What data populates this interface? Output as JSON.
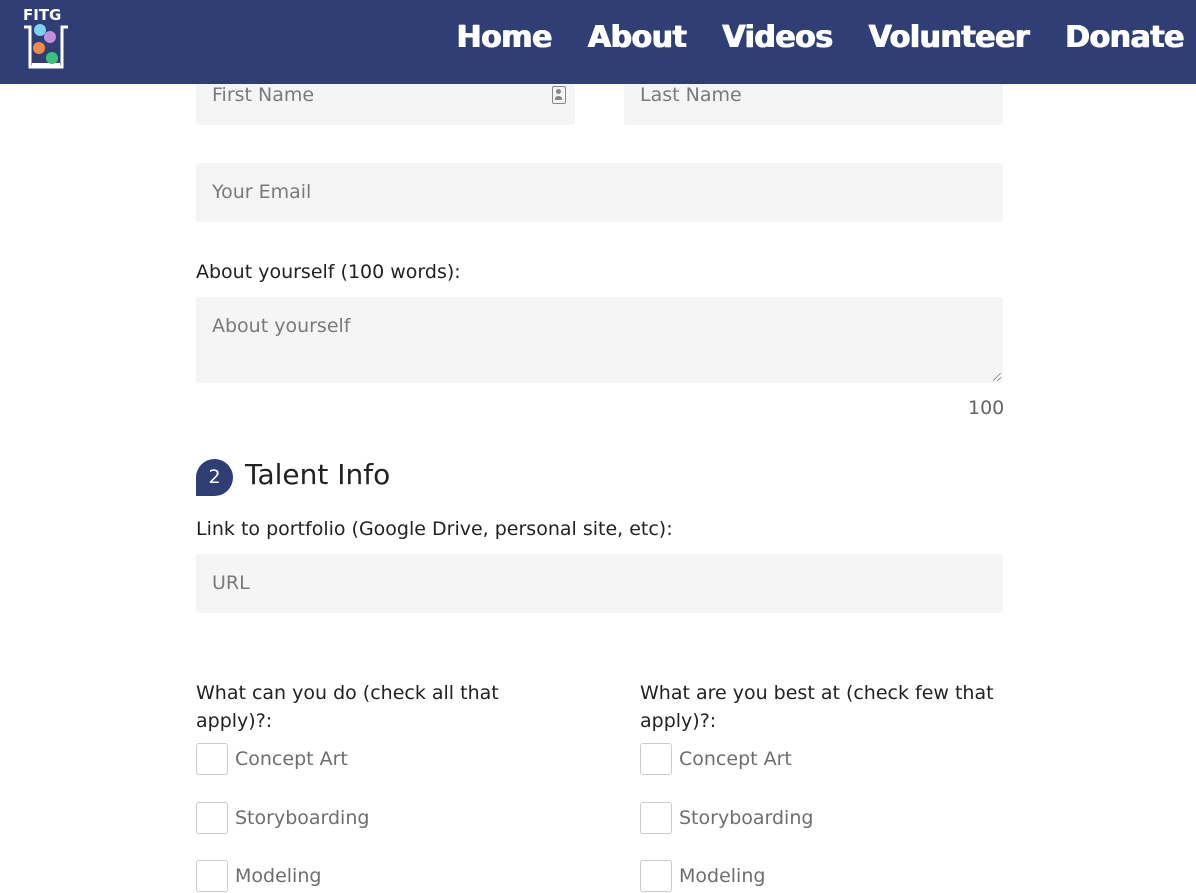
{
  "header": {
    "logo_text": "FITG",
    "nav": [
      "Home",
      "About",
      "Videos",
      "Volunteer",
      "Donate"
    ]
  },
  "form": {
    "first_name_placeholder": "First Name",
    "last_name_placeholder": "Last Name",
    "email_placeholder": "Your Email",
    "about_label": "About yourself (100 words):",
    "about_placeholder": "About yourself",
    "about_counter": "100",
    "section2_number": "2",
    "section2_title": "Talent Info",
    "portfolio_label": "Link to portfolio (Google Drive, personal site, etc):",
    "portfolio_placeholder": "URL",
    "can_do_label_line1": "What can you do (check all that",
    "can_do_label_line2": "apply)?:",
    "best_at_label_line1": "What are you best at (check few that",
    "best_at_label_line2": "apply)?:",
    "can_do_options": [
      "Concept Art",
      "Storyboarding",
      "Modeling"
    ],
    "best_at_options": [
      "Concept Art",
      "Storyboarding",
      "Modeling"
    ]
  },
  "colors": {
    "header_bg": "#2f3f75",
    "field_bg": "#f5f5f5",
    "badge_bg": "#2f3f75"
  }
}
